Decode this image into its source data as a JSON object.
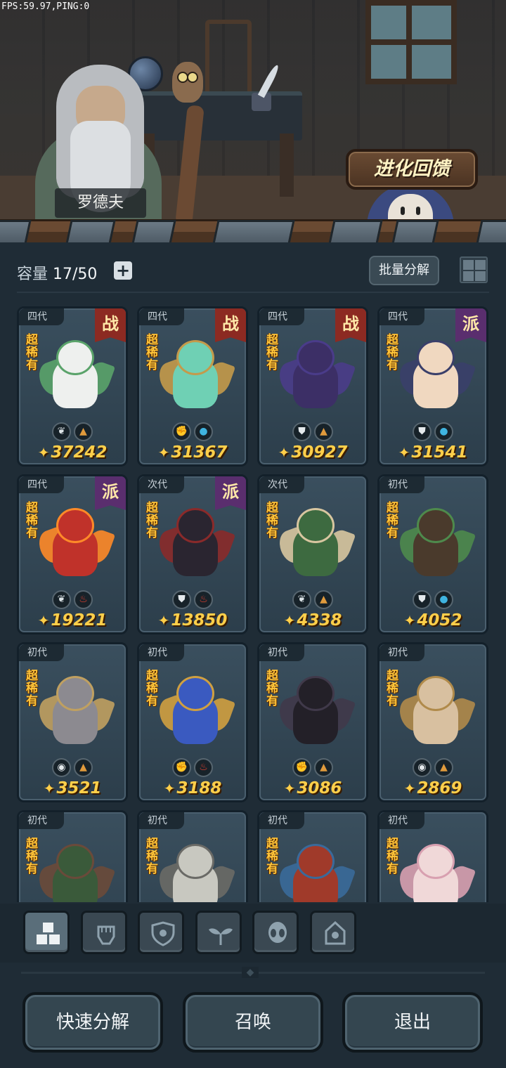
{
  "debug": {
    "fps": "FPS:59.97,PING:0"
  },
  "banner": {
    "npc_name": "罗德夫",
    "evolve_button": "进化回馈"
  },
  "toolbar": {
    "capacity_label": "容量",
    "capacity_value": "17/50",
    "add_icon": "plus-icon",
    "batch_button": "批量分解",
    "view_toggle_icon": "grid-view-icon"
  },
  "cards": [
    {
      "gen": "四代",
      "role": "战",
      "role_color": "#8c2a22",
      "rarity": "超稀有",
      "attrs": [
        "leaf-icon",
        "earth-icon"
      ],
      "power": "37242",
      "colors": [
        "#eef0ee",
        "#5aa36a"
      ]
    },
    {
      "gen": "四代",
      "role": "战",
      "role_color": "#8c2a22",
      "rarity": "超稀有",
      "attrs": [
        "fist-icon",
        "water-icon"
      ],
      "power": "31367",
      "colors": [
        "#6fd0b4",
        "#c49a4a"
      ]
    },
    {
      "gen": "四代",
      "role": "战",
      "role_color": "#8c2a22",
      "rarity": "超稀有",
      "attrs": [
        "shield-icon",
        "earth-icon"
      ],
      "power": "30927",
      "colors": [
        "#3c2f66",
        "#4a3c8a"
      ]
    },
    {
      "gen": "四代",
      "role": "派",
      "role_color": "#5a2e6e",
      "rarity": "超稀有",
      "attrs": [
        "shield-icon",
        "water-icon"
      ],
      "power": "31541",
      "colors": [
        "#f0d8c0",
        "#3a3f6a"
      ]
    },
    {
      "gen": "四代",
      "role": "派",
      "role_color": "#5a2e6e",
      "rarity": "超稀有",
      "attrs": [
        "leaf-icon",
        "fire-icon"
      ],
      "power": "19221",
      "colors": [
        "#c0322a",
        "#ff8a28"
      ]
    },
    {
      "gen": "次代",
      "role": "派",
      "role_color": "#5a2e6e",
      "rarity": "超稀有",
      "attrs": [
        "shield-icon",
        "fire-icon"
      ],
      "power": "13850",
      "colors": [
        "#2a2530",
        "#8a2a2a"
      ]
    },
    {
      "gen": "次代",
      "role": "",
      "role_color": "",
      "rarity": "超稀有",
      "attrs": [
        "leaf-icon",
        "earth-icon"
      ],
      "power": "4338",
      "colors": [
        "#3d6a40",
        "#d8c6a0"
      ]
    },
    {
      "gen": "初代",
      "role": "",
      "role_color": "",
      "rarity": "超稀有",
      "attrs": [
        "shield-icon",
        "water-icon"
      ],
      "power": "4052",
      "colors": [
        "#4a3a2c",
        "#4e8a4c"
      ]
    },
    {
      "gen": "初代",
      "role": "",
      "role_color": "",
      "rarity": "超稀有",
      "attrs": [
        "alien-icon",
        "earth-icon"
      ],
      "power": "3521",
      "colors": [
        "#8c8a90",
        "#c0a060"
      ]
    },
    {
      "gen": "初代",
      "role": "",
      "role_color": "",
      "rarity": "超稀有",
      "attrs": [
        "fist-icon",
        "fire-icon"
      ],
      "power": "3188",
      "colors": [
        "#3a5ac0",
        "#d0a040"
      ]
    },
    {
      "gen": "初代",
      "role": "",
      "role_color": "",
      "rarity": "超稀有",
      "attrs": [
        "fist-icon",
        "earth-icon"
      ],
      "power": "3086",
      "colors": [
        "#232028",
        "#40394a"
      ]
    },
    {
      "gen": "初代",
      "role": "",
      "role_color": "",
      "rarity": "超稀有",
      "attrs": [
        "alien-icon",
        "earth-icon"
      ],
      "power": "2869",
      "colors": [
        "#d8c0a0",
        "#b08a4a"
      ]
    },
    {
      "gen": "初代",
      "role": "",
      "role_color": "",
      "rarity": "超稀有",
      "attrs": [],
      "power": "",
      "colors": [
        "#3a5a3a",
        "#6a4a3a"
      ]
    },
    {
      "gen": "初代",
      "role": "",
      "role_color": "",
      "rarity": "超稀有",
      "attrs": [],
      "power": "",
      "colors": [
        "#c8c8c0",
        "#6a6a66"
      ]
    },
    {
      "gen": "初代",
      "role": "",
      "role_color": "",
      "rarity": "超稀有",
      "attrs": [],
      "power": "",
      "colors": [
        "#a03a2a",
        "#3a6a9a"
      ]
    },
    {
      "gen": "初代",
      "role": "",
      "role_color": "",
      "rarity": "超稀有",
      "attrs": [],
      "power": "",
      "colors": [
        "#f0d8d8",
        "#d8a0b0"
      ]
    }
  ],
  "power_icon": "power-icon",
  "filter_tabs": [
    {
      "icon": "all-blocks-icon",
      "active": true
    },
    {
      "icon": "fist-icon",
      "active": false
    },
    {
      "icon": "shield-icon",
      "active": false
    },
    {
      "icon": "leaf-icon",
      "active": false
    },
    {
      "icon": "alien-icon",
      "active": false
    },
    {
      "icon": "tower-icon",
      "active": false
    }
  ],
  "bottom_buttons": {
    "quick_decompose": "快速分解",
    "summon": "召唤",
    "exit": "退出"
  }
}
